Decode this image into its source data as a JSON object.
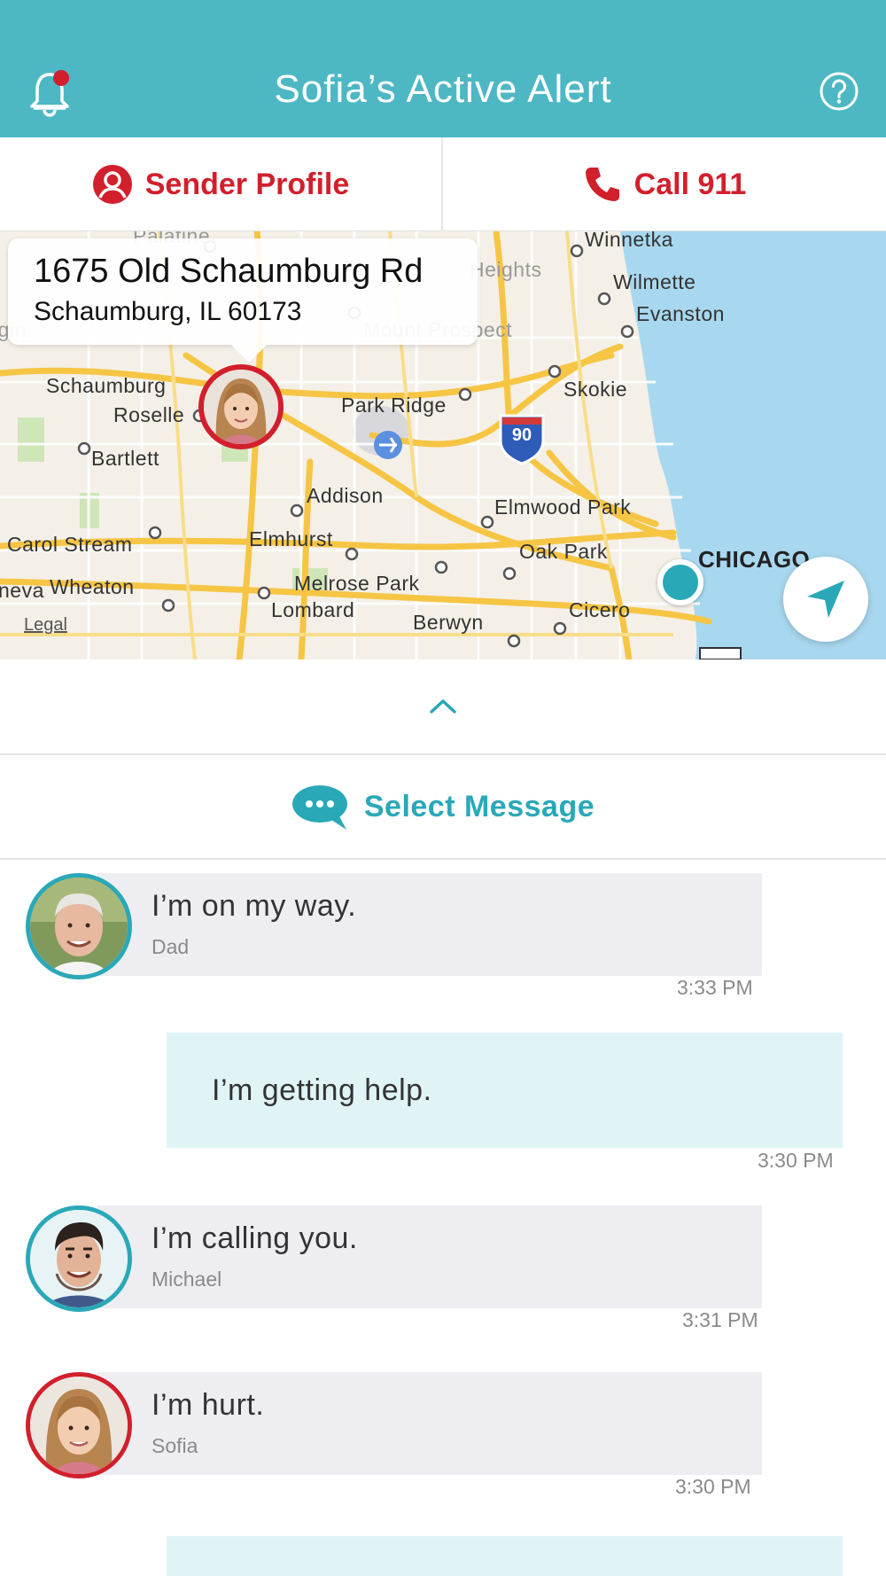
{
  "header": {
    "title": "Sofia’s Active Alert",
    "bell_icon": "bell-icon",
    "help_icon": "question-circle-icon"
  },
  "actions": {
    "sender_profile": "Sender Profile",
    "call_911": "Call 911",
    "accent_color": "#d21f2c"
  },
  "map": {
    "address_line1": "1675 Old Schaumburg Rd",
    "address_line2": "Schaumburg, IL 60173",
    "legal": "Legal",
    "interstate": "90",
    "places": {
      "palatine": "Palatine",
      "winnetka": "Winnetka",
      "heights": "Heights",
      "wilmette": "Wilmette",
      "evanston": "Evanston",
      "mount_prospect": "Mount Prospect",
      "skokie": "Skokie",
      "schaumburg": "Schaumburg",
      "roselle": "Roselle",
      "park_ridge": "Park Ridge",
      "bartlett": "Bartlett",
      "addison": "Addison",
      "elmwood_park": "Elmwood Park",
      "carol_stream": "Carol Stream",
      "elmhurst": "Elmhurst",
      "oak_park": "Oak Park",
      "chicago": "CHICAGO",
      "wheaton": "Wheaton",
      "geneva": "neva",
      "melrose_park": "Melrose Park",
      "lombard": "Lombard",
      "berwyn": "Berwyn",
      "cicero": "Cicero",
      "elgin": "lgin"
    }
  },
  "select_message": {
    "label": "Select Message"
  },
  "messages": [
    {
      "text": "I’m on my way.",
      "sender": "Dad",
      "time": "3:33 PM"
    },
    {
      "text": "I’m getting help.",
      "time": "3:30 PM"
    },
    {
      "text": "I’m calling you.",
      "sender": "Michael",
      "time": "3:31 PM"
    },
    {
      "text": "I’m hurt.",
      "sender": "Sofia",
      "time": "3:30 PM"
    }
  ],
  "colors": {
    "header": "#4db8c4",
    "teal": "#2aa8b8",
    "red": "#d21f2c",
    "incoming_bubble": "#eeeef2",
    "outgoing_bubble": "#e0f4f6"
  }
}
